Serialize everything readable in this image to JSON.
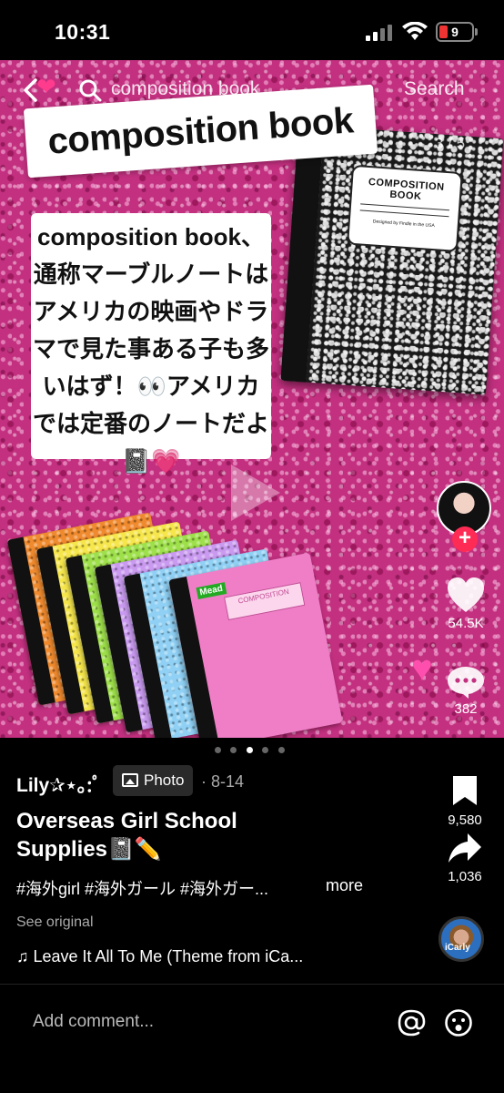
{
  "status_bar": {
    "time": "10:31",
    "battery": "9"
  },
  "nav": {
    "search_query": "composition book",
    "search_button": "Search"
  },
  "post_image": {
    "title_banner": "composition book",
    "page_counter": "3 / 5",
    "description": "composition book、通称マーブルノートはアメリカの映画やドラマで見た事ある子も多いはず！👀アメリカでは定番のノートだよ📓💗",
    "book_label": "COMPOSITION BOOK",
    "book_subtitle": "Designed by Findle in the USA",
    "notebook_brand": "Mead",
    "notebook_label": "COMPOSITION"
  },
  "rail": {
    "likes": "54.5K",
    "comments": "382",
    "saves": "9,580",
    "shares": "1,036"
  },
  "post": {
    "author": "Lily✰⋆｡:ﾟ",
    "badge": "Photo",
    "date": "· 8-14",
    "title": "Overseas Girl School Supplies📓✏️",
    "hashtags": "#海外girl #海外ガール #海外ガー...",
    "more": "more",
    "see_original": "See original",
    "music": "♫ Leave It All To Me (Theme from iCa..."
  },
  "carousel": {
    "total": 5,
    "active_index": 3
  },
  "comment_bar": {
    "placeholder": "Add comment..."
  },
  "colors": {
    "like_red": "#fe2c55",
    "glitter_pink": "#c2307f"
  },
  "icons": [
    "back-icon",
    "search-icon",
    "play-icon",
    "heart-icon",
    "comment-icon",
    "bookmark-icon",
    "share-icon",
    "at-icon",
    "emoji-icon"
  ]
}
